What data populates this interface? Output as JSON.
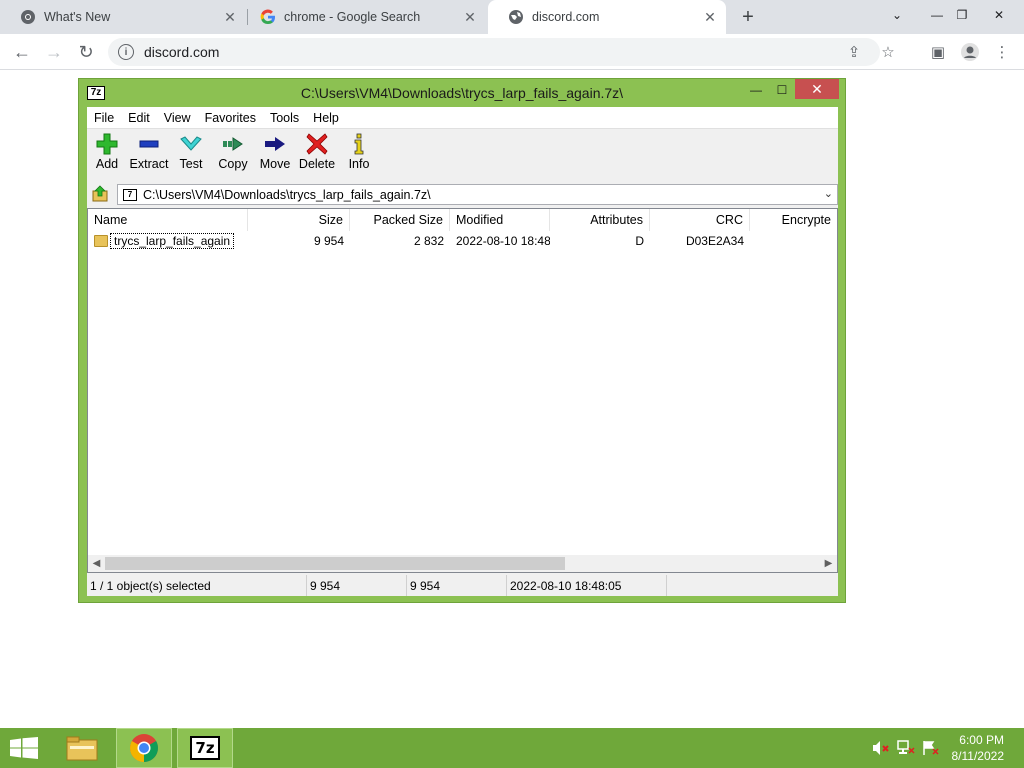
{
  "browser": {
    "tabs": [
      {
        "title": "What's New",
        "favicon": "chrome-icon",
        "active": false
      },
      {
        "title": "chrome - Google Search",
        "favicon": "google-icon",
        "active": false
      },
      {
        "title": "discord.com",
        "favicon": "globe-icon",
        "active": true
      }
    ],
    "url": "discord.com"
  },
  "zip": {
    "title": "C:\\Users\\VM4\\Downloads\\trycs_larp_fails_again.7z\\",
    "app_icon_text": "7z",
    "menu": [
      "File",
      "Edit",
      "View",
      "Favorites",
      "Tools",
      "Help"
    ],
    "toolbar": [
      {
        "label": "Add",
        "icon": "plus-icon"
      },
      {
        "label": "Extract",
        "icon": "minus-icon"
      },
      {
        "label": "Test",
        "icon": "check-icon"
      },
      {
        "label": "Copy",
        "icon": "copy-arrow-icon"
      },
      {
        "label": "Move",
        "icon": "move-arrow-icon"
      },
      {
        "label": "Delete",
        "icon": "x-icon"
      },
      {
        "label": "Info",
        "icon": "info-icon"
      }
    ],
    "address": "C:\\Users\\VM4\\Downloads\\trycs_larp_fails_again.7z\\",
    "columns": [
      "Name",
      "Size",
      "Packed Size",
      "Modified",
      "Attributes",
      "CRC",
      "Encrypte"
    ],
    "rows": [
      {
        "name": "trycs_larp_fails_again",
        "size": "9 954",
        "packed": "2 832",
        "modified": "2022-08-10 18:48",
        "attributes": "D",
        "crc": "D03E2A34",
        "encrypted": ""
      }
    ],
    "status": {
      "selected": "1 / 1 object(s) selected",
      "size": "9 954",
      "packed": "9 954",
      "modified": "2022-08-10 18:48:05"
    }
  },
  "taskbar": {
    "time": "6:00 PM",
    "date": "8/11/2022",
    "sevenzip_label": "7z"
  }
}
